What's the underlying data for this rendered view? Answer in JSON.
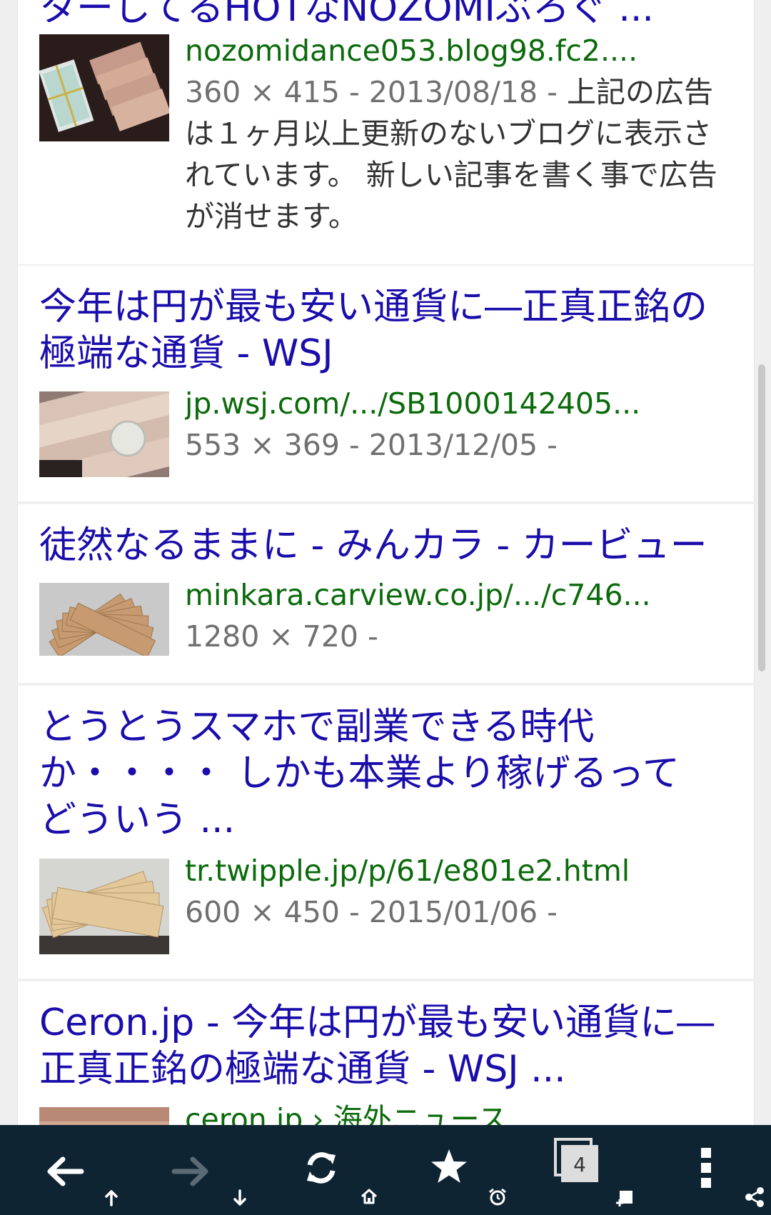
{
  "results": [
    {
      "title": "ターしてるHOTなNOZOMIぶろぐ ...",
      "url": "nozomidance053.blog98.fc2....",
      "dimensions": "360 × 415 - 2013/08/18 - ",
      "description": "上記の広告は１ヶ月以上更新のないブログに表示されています。 新しい記事を書く事で広告が消せます。",
      "thumbnail": "thumbnail-envelope-and-yen-notes"
    },
    {
      "title": "今年は円が最も安い通貨に―正真正銘の極端な通貨 - WSJ",
      "url": "jp.wsj.com/.../SB1000142405...",
      "dimensions": "553 × 369 - 2013/12/05 - ",
      "description": "",
      "thumbnail": "thumbnail-yen-notes-and-coin"
    },
    {
      "title": "徒然なるままに - みんカラ - カービュー",
      "url": "minkara.carview.co.jp/.../c746...",
      "dimensions": "1280 × 720 - ",
      "description": "",
      "thumbnail": "thumbnail-fanned-yen-notes"
    },
    {
      "title": "とうとうスマホで副業できる時代か・・・・ しかも本業より稼げるってどういう ...",
      "url": "tr.twipple.jp/p/61/e801e2.html",
      "dimensions": "600 × 450 - 2015/01/06 - ",
      "description": "",
      "thumbnail": "thumbnail-yen-notes-on-table"
    },
    {
      "title": "Ceron.jp - 今年は円が最も安い通貨に―正真正銘の極端な通貨 - WSJ ...",
      "url": "ceron.jp › 海外ニュース",
      "dimensions": "",
      "description": "",
      "thumbnail": "thumbnail-yen-notes"
    }
  ],
  "toolbar": {
    "tab_count": "4",
    "icons": [
      "back-icon",
      "scroll-top-icon",
      "forward-icon",
      "scroll-bottom-icon",
      "reload-icon",
      "home-icon",
      "bookmark-star-icon",
      "alarm-icon",
      "tabs-icon",
      "new-tab-icon",
      "menu-icon",
      "share-icon"
    ]
  },
  "colors": {
    "title_link": "#1a0dab",
    "url": "#0b6a0b",
    "meta": "#707070",
    "toolbar_bg": "#0f2433",
    "forward_disabled": "#5b6b76"
  }
}
